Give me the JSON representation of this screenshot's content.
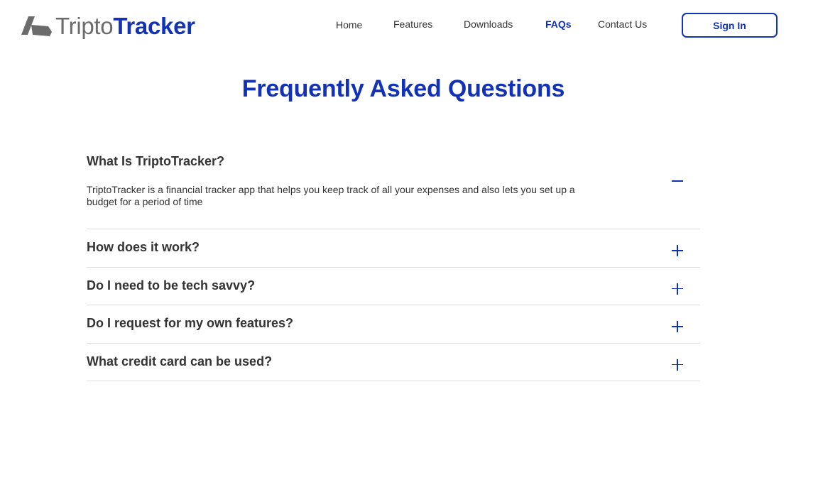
{
  "brand": {
    "name_part1": "Tripto",
    "name_part2": "Tracker",
    "colors": {
      "primary": "#1232b8",
      "text": "#333333",
      "logo_gray": "#6b6b6b",
      "divider": "#dedede"
    }
  },
  "nav": {
    "items": [
      {
        "label": "Home",
        "active": false
      },
      {
        "label": "Features",
        "active": false
      },
      {
        "label": "Downloads",
        "active": false
      },
      {
        "label": "FAQs",
        "active": true
      },
      {
        "label": "Contact Us",
        "active": false
      }
    ],
    "signin_label": "Sign In"
  },
  "page": {
    "title": "Frequently Asked Questions"
  },
  "faqs": [
    {
      "question": "What Is TriptoTracker?",
      "answer": "TriptoTracker is a financial tracker app that helps you keep track of all your expenses and also lets you set up a budget for a period of time",
      "expanded": true,
      "toggle_icon": "minus-icon"
    },
    {
      "question": "How does it work?",
      "expanded": false,
      "toggle_icon": "plus-icon"
    },
    {
      "question": "Do I need to be tech savvy?",
      "expanded": false,
      "toggle_icon": "plus-icon"
    },
    {
      "question": "Do I request for my own features?",
      "expanded": false,
      "toggle_icon": "plus-icon"
    },
    {
      "question": "What credit card can be used?",
      "expanded": false,
      "toggle_icon": "plus-icon"
    }
  ]
}
